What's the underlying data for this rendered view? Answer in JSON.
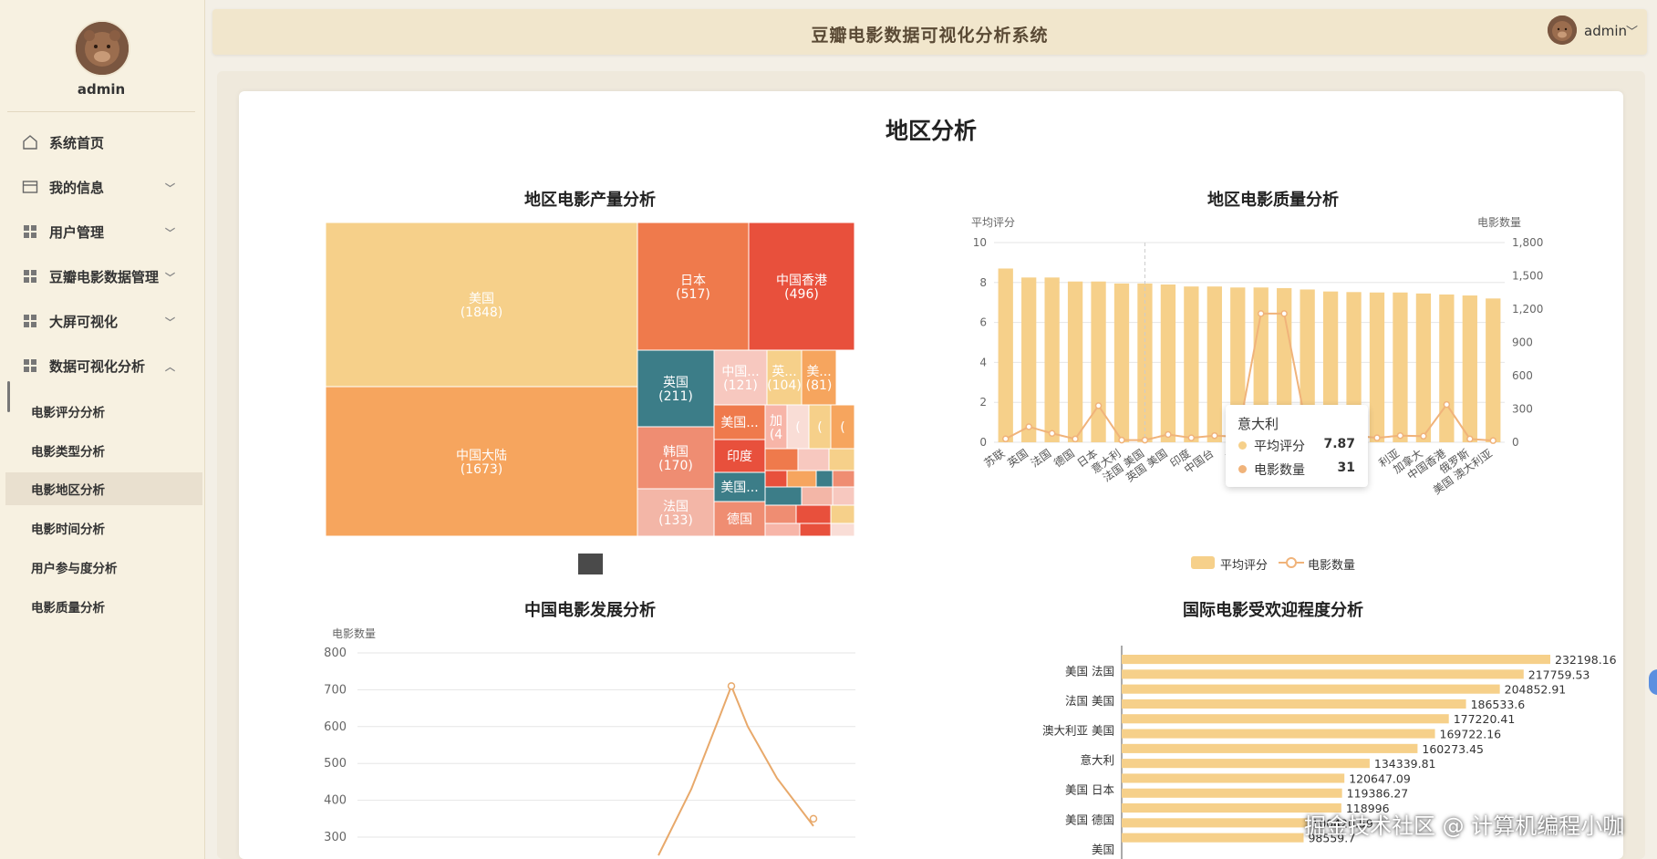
{
  "app": {
    "title": "豆瓣电影数据可视化分析系统",
    "user": "admin"
  },
  "sidebar": {
    "user": "admin",
    "items": [
      {
        "label": "系统首页",
        "icon": "home-icon",
        "chevron": ""
      },
      {
        "label": "我的信息",
        "icon": "card-icon",
        "chevron": "down"
      },
      {
        "label": "用户管理",
        "icon": "grid-icon",
        "chevron": "down"
      },
      {
        "label": "豆瓣电影数据管理",
        "icon": "grid-icon",
        "chevron": "down"
      },
      {
        "label": "大屏可视化",
        "icon": "grid-icon",
        "chevron": "down"
      },
      {
        "label": "数据可视化分析",
        "icon": "grid-icon",
        "chevron": "up"
      }
    ],
    "subitems": [
      {
        "label": "电影评分分析",
        "active": false
      },
      {
        "label": "电影类型分析",
        "active": false
      },
      {
        "label": "电影地区分析",
        "active": true
      },
      {
        "label": "电影时间分析",
        "active": false
      },
      {
        "label": "用户参与度分析",
        "active": false
      },
      {
        "label": "电影质量分析",
        "active": false
      }
    ]
  },
  "page": {
    "title": "地区分析"
  },
  "watermark": "掘金技术社区 @ 计算机编程小咖",
  "chart_data": [
    {
      "type": "treemap",
      "title": "地区电影产量分析",
      "nodes": [
        {
          "label": "美国",
          "value_label": "(1848)",
          "value": 1848,
          "color": "#f6d08a"
        },
        {
          "label": "中国大陆",
          "value_label": "(1673)",
          "value": 1673,
          "color": "#f6a55e"
        },
        {
          "label": "日本",
          "value_label": "(517)",
          "value": 517,
          "color": "#ef7a4c"
        },
        {
          "label": "中国香港",
          "value_label": "(496)",
          "value": 496,
          "color": "#e8503c"
        },
        {
          "label": "英国",
          "value_label": "(211)",
          "value": 211,
          "color": "#3c7d88"
        },
        {
          "label": "中国...",
          "value_label": "(121)",
          "value": 121,
          "color": "#f7c8bf"
        },
        {
          "label": "英...",
          "value_label": "(104)",
          "value": 104,
          "color": "#f6d08a"
        },
        {
          "label": "美...",
          "value_label": "(81)",
          "value": 81,
          "color": "#f6a55e"
        },
        {
          "label": "韩国",
          "value_label": "(170)",
          "value": 170,
          "color": "#ef8d72"
        },
        {
          "label": "美国...",
          "value_label": "",
          "value": 60,
          "color": "#ef7a4c"
        },
        {
          "label": "加",
          "value_label": "(4",
          "value": 40,
          "color": "#f7b5a8"
        },
        {
          "label": "(",
          "value_label": "",
          "value": 20,
          "color": "#f9ddd6"
        },
        {
          "label": "(",
          "value_label": "",
          "value": 20,
          "color": "#f6d08a"
        },
        {
          "label": "(",
          "value_label": "",
          "value": 20,
          "color": "#f6a55e"
        },
        {
          "label": "印度",
          "value_label": "",
          "value": 60,
          "color": "#e8503c"
        },
        {
          "label": "法国",
          "value_label": "(133)",
          "value": 133,
          "color": "#f3b6a7"
        },
        {
          "label": "美国...",
          "value_label": "",
          "value": 55,
          "color": "#3c7d88"
        },
        {
          "label": "德国",
          "value_label": "",
          "value": 55,
          "color": "#ef8d72"
        }
      ],
      "legend_color": "#4a4a4a"
    },
    {
      "type": "bar-line",
      "title": "地区电影质量分析",
      "categories": [
        "苏联",
        "英国",
        "法国",
        "德国",
        "日本",
        "意大利",
        "法国 美国",
        "英国 美国",
        "印度",
        "中国台湾",
        "美国",
        "",
        "",
        "",
        "",
        "意大利",
        "",
        "澳大利亚",
        "加拿大",
        "中国香港",
        "俄罗斯",
        "美国 澳大利亚"
      ],
      "x_tick_labels": [
        "苏联",
        "英国",
        "法国",
        "德国",
        "日本",
        "意大利",
        "法国 美国",
        "英国 美国",
        "印度",
        "中国台",
        "美",
        "利亚",
        "加拿大",
        "中国香港",
        "俄罗斯",
        "美国 澳大利亚"
      ],
      "series": [
        {
          "name": "平均评分",
          "kind": "bar",
          "axis": "left",
          "color": "#f6d08a",
          "values": [
            8.7,
            8.25,
            8.25,
            8.05,
            8.05,
            7.95,
            7.95,
            7.9,
            7.8,
            7.8,
            7.75,
            7.75,
            7.72,
            7.65,
            7.55,
            7.52,
            7.5,
            7.5,
            7.45,
            7.4,
            7.35,
            7.2
          ]
        },
        {
          "name": "电影数量",
          "kind": "line",
          "axis": "right",
          "color": "#f0b37a",
          "values": [
            31,
            140,
            80,
            30,
            330,
            20,
            20,
            70,
            40,
            60,
            50,
            1160,
            1160,
            90,
            70,
            60,
            40,
            60,
            55,
            340,
            30,
            15
          ]
        }
      ],
      "y_left": {
        "name": "平均评分",
        "min": 0,
        "max": 10,
        "ticks": [
          "0",
          "2",
          "4",
          "6",
          "8",
          "10"
        ]
      },
      "y_right": {
        "name": "电影数量",
        "min": 0,
        "max": 1800,
        "ticks": [
          "0",
          "300",
          "600",
          "900",
          "1,200",
          "1,500",
          "1,800"
        ]
      },
      "tooltip": {
        "title": "意大利",
        "rows": [
          {
            "name": "平均评分",
            "value": "7.87",
            "color": "#f6d08a"
          },
          {
            "name": "电影数量",
            "value": "31",
            "color": "#f0b37a"
          }
        ]
      }
    },
    {
      "type": "line",
      "title": "中国电影发展分析",
      "ylabel": "电影数量",
      "ylim": [
        300,
        800
      ],
      "y_ticks": [
        "800",
        "700",
        "600",
        "500",
        "400",
        "300"
      ],
      "series": [
        {
          "name": "",
          "color": "#e8a96b",
          "values": [
            300,
            430,
            620,
            710,
            600,
            460,
            330
          ]
        }
      ]
    },
    {
      "type": "bar",
      "orientation": "horizontal",
      "title": "国际电影受欢迎程度分析",
      "category_labels": [
        "美国 法国",
        "法国 美国",
        "澳大利亚 美国",
        "意大利",
        "美国 日本",
        "美国 德国",
        "美国"
      ],
      "values": [
        232198.16,
        217759.53,
        204852.91,
        186533.6,
        177220.41,
        169722.16,
        160273.45,
        134339.81,
        120647.09,
        119386.27,
        118996,
        100420.59,
        98559.7
      ],
      "value_labels": [
        "232198.16",
        "217759.53",
        "204852.91",
        "186533.6",
        "177220.41",
        "169722.16",
        "160273.45",
        "134339.81",
        "120647.09",
        "119386.27",
        "118996",
        "100420.59",
        "98559.7"
      ],
      "color": "#f6d08a"
    }
  ]
}
